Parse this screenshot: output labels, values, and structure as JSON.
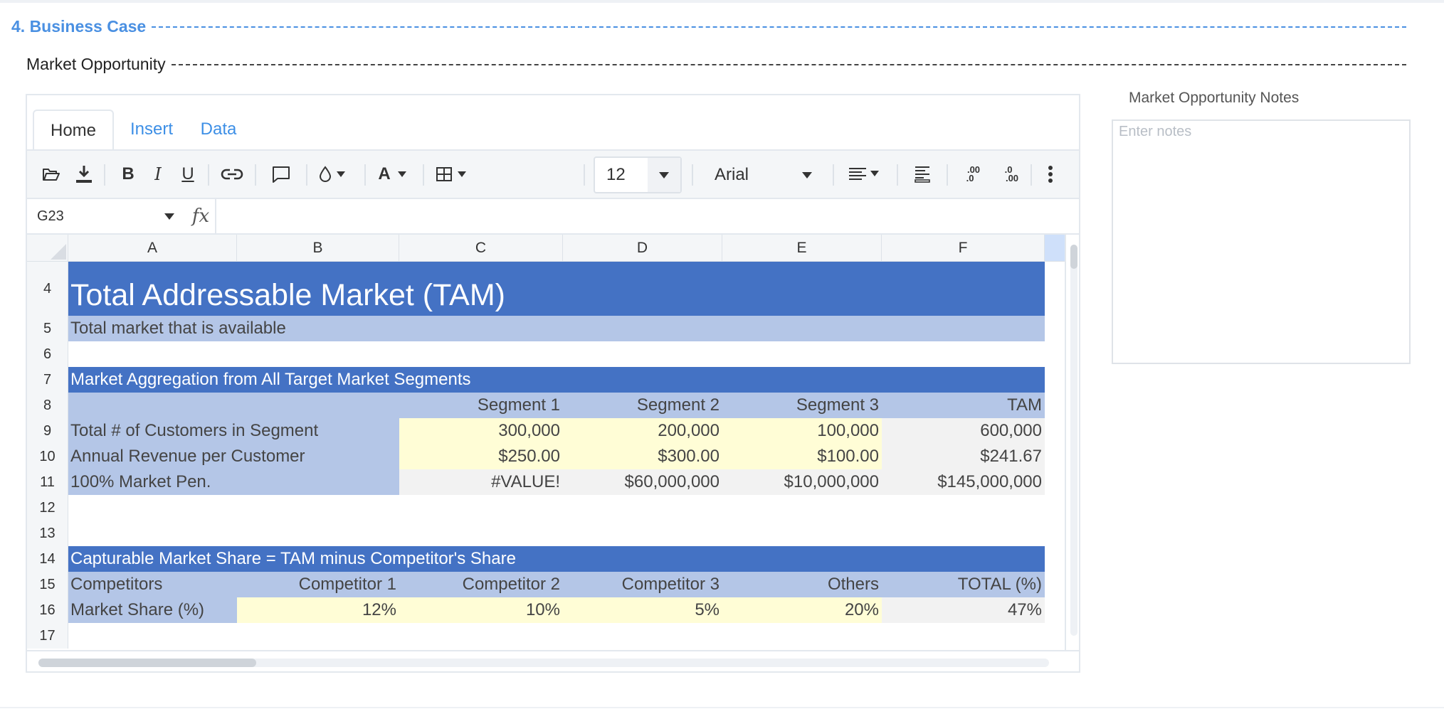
{
  "section": {
    "title": "4. Business Case",
    "subtitle": "Market Opportunity"
  },
  "colors": {
    "accent": "#4a90e2",
    "header_dark": "#4472c4",
    "header_light": "#b4c6e7",
    "input_yellow": "#fffdd6",
    "calc_gray": "#f2f2f2"
  },
  "sheet": {
    "tabs": [
      {
        "label": "Home",
        "active": true
      },
      {
        "label": "Insert",
        "active": false
      },
      {
        "label": "Data",
        "active": false
      }
    ],
    "toolbar": {
      "font_size": "12",
      "font_name": "Arial",
      "icons": [
        "folder-open-icon",
        "download-icon",
        "bold-icon",
        "italic-icon",
        "underline-icon",
        "link-icon",
        "comment-icon",
        "fill-color-icon",
        "text-color-icon",
        "borders-icon",
        "align-icon",
        "wrap-icon",
        "increase-decimal-icon",
        "decrease-decimal-icon",
        "more-icon"
      ],
      "bold": "B",
      "italic": "I",
      "underline": "U",
      "text_color": "A",
      "inc_decimal_top": ".00",
      "inc_decimal_bottom": ".0",
      "dec_decimal_top": ".0",
      "dec_decimal_bottom": ".00"
    },
    "formula_bar": {
      "name_box": "G23",
      "fx": "fx",
      "formula": ""
    },
    "columns": [
      "A",
      "B",
      "C",
      "D",
      "E",
      "F"
    ],
    "rows": {
      "r4": {
        "num": "4",
        "A": "Total Addressable Market (TAM)"
      },
      "r5": {
        "num": "5",
        "A": "Total market that is available"
      },
      "r6": {
        "num": "6"
      },
      "r7": {
        "num": "7",
        "A": "Market Aggregation from All Target Market Segments"
      },
      "r8": {
        "num": "8",
        "C": "Segment 1",
        "D": "Segment 2",
        "E": "Segment 3",
        "F": "TAM"
      },
      "r9": {
        "num": "9",
        "A": "Total # of Customers in Segment",
        "C": "300,000",
        "D": "200,000",
        "E": "100,000",
        "F": "600,000"
      },
      "r10": {
        "num": "10",
        "A": "Annual Revenue per Customer",
        "C": "$250.00",
        "D": "$300.00",
        "E": "$100.00",
        "F": "$241.67"
      },
      "r11": {
        "num": "11",
        "A": "100% Market Pen.",
        "C": "#VALUE!",
        "D": "$60,000,000",
        "E": "$10,000,000",
        "F": "$145,000,000"
      },
      "r12": {
        "num": "12"
      },
      "r13": {
        "num": "13"
      },
      "r14": {
        "num": "14",
        "A": "Capturable Market Share = TAM minus Competitor's Share"
      },
      "r15": {
        "num": "15",
        "A": "Competitors",
        "B": "Competitor 1",
        "C": "Competitor 2",
        "D": "Competitor 3",
        "E": "Others",
        "F": "TOTAL (%)"
      },
      "r16": {
        "num": "16",
        "A": "Market Share (%)",
        "B": "12%",
        "C": "10%",
        "D": "5%",
        "E": "20%",
        "F": "47%"
      },
      "r17": {
        "num": "17"
      }
    }
  },
  "notes": {
    "label": "Market Opportunity Notes",
    "placeholder": "Enter notes",
    "value": ""
  }
}
